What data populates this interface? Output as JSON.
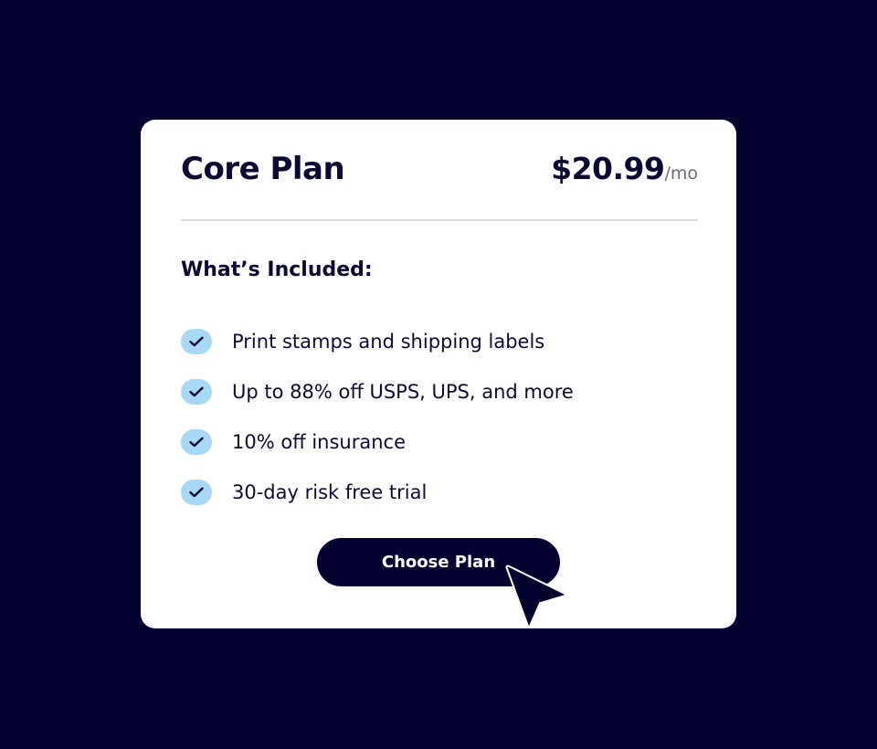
{
  "plan": {
    "name": "Core Plan",
    "price": "$20.99",
    "period": "/mo"
  },
  "included": {
    "title": "What’s Included:",
    "items": [
      "Print stamps and shipping labels",
      "Up to 88% off USPS, UPS, and more",
      "10% off insurance",
      "30-day risk free trial"
    ],
    "icon": "check-icon"
  },
  "cta": {
    "label": "Choose Plan"
  },
  "colors": {
    "background": "#03022e",
    "card": "#ffffff",
    "text": "#0b0a33",
    "check_bg": "#a7d8f5",
    "button": "#03022e"
  }
}
